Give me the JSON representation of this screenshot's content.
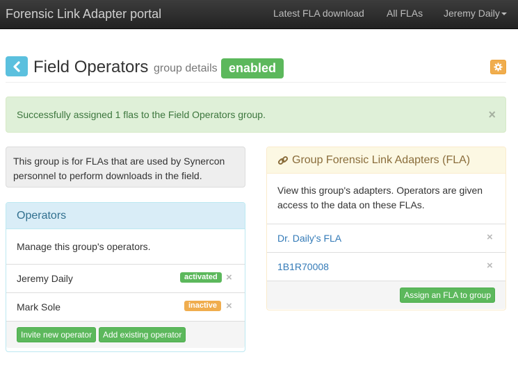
{
  "navbar": {
    "brand": "Forensic Link Adapter portal",
    "links": [
      "Latest FLA download",
      "All FLAs"
    ],
    "user": "Jeremy Daily"
  },
  "header": {
    "title": "Field Operators",
    "subtitle": "group details",
    "status": "enabled"
  },
  "alert": {
    "message": "Successfully assigned 1 flas to the Field Operators group.",
    "close": "×"
  },
  "description": "This group is for FLAs that are used by Synercon personnel to perform downloads in the field.",
  "operators": {
    "heading": "Operators",
    "intro": "Manage this group's operators.",
    "rows": [
      {
        "name": "Jeremy Daily",
        "status": "activated"
      },
      {
        "name": "Mark Sole",
        "status": "inactive"
      }
    ],
    "remove": "×",
    "invite_label": "Invite new operator",
    "add_label": "Add existing operator"
  },
  "flas": {
    "heading": "Group Forensic Link Adapters (FLA)",
    "intro": "View this group's adapters. Operators are given access to the data on these FLAs.",
    "rows": [
      {
        "name": "Dr. Daily's FLA"
      },
      {
        "name": "1B1R70008"
      }
    ],
    "remove": "×",
    "assign_label": "Assign an FLA to group"
  },
  "colors": {
    "success": "#5cb85c",
    "warning": "#f0ad4e",
    "info": "#5bc0de",
    "link": "#337ab7"
  }
}
